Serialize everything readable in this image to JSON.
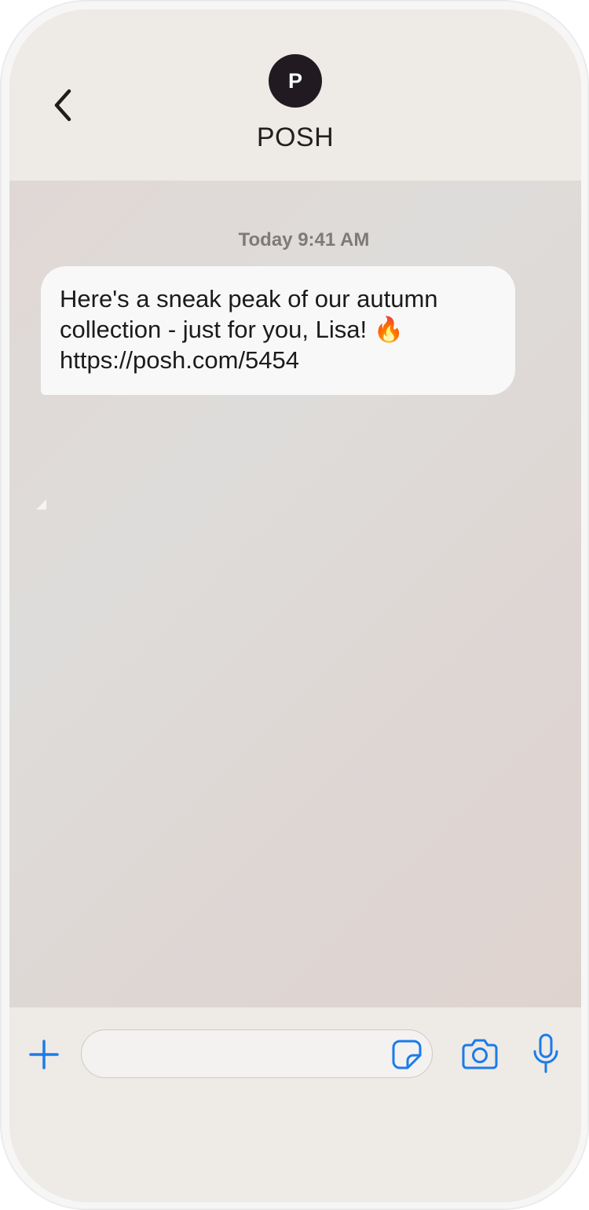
{
  "header": {
    "back_label": "Back",
    "avatar_initial": "P",
    "contact_name": "POSH"
  },
  "chat": {
    "timestamp": "Today 9:41 AM",
    "messages": [
      {
        "direction": "incoming",
        "lines": [
          "Here's a sneak peak of our autumn",
          "collection - just for you, Lisa! 🔥",
          "https://posh.com/5454"
        ]
      }
    ]
  },
  "composer": {
    "input_value": "",
    "input_placeholder": "",
    "icons": [
      "plus-icon",
      "sticker-icon",
      "camera-icon",
      "microphone-icon"
    ]
  },
  "colors": {
    "accent": "#1a7bea",
    "avatar_bg": "#221a21",
    "bubble_bg": "#f8f8f8",
    "header_bg": "#eeeae5",
    "chat_bg": "#ded9d6",
    "timestamp": "#7f7a78"
  }
}
